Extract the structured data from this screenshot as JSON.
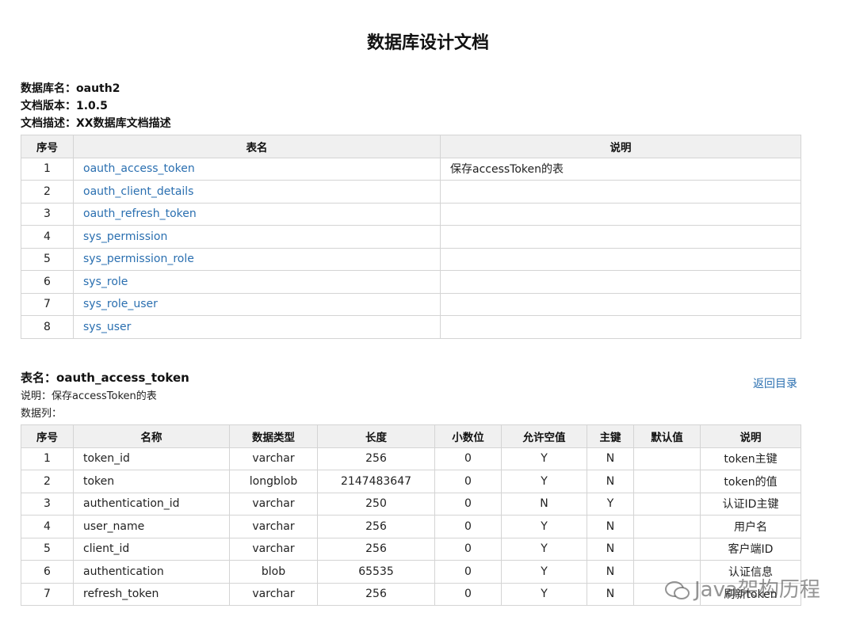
{
  "doc": {
    "title": "数据库设计文档",
    "meta": [
      {
        "label": "数据库名：",
        "value": "oauth2"
      },
      {
        "label": "文档版本：",
        "value": "1.0.5"
      },
      {
        "label": "文档描述：",
        "value": "XX数据库文档描述"
      }
    ]
  },
  "index_table": {
    "headers": [
      "序号",
      "表名",
      "说明"
    ],
    "rows": [
      {
        "no": "1",
        "name": "oauth_access_token",
        "desc": "保存accessToken的表"
      },
      {
        "no": "2",
        "name": "oauth_client_details",
        "desc": ""
      },
      {
        "no": "3",
        "name": "oauth_refresh_token",
        "desc": ""
      },
      {
        "no": "4",
        "name": "sys_permission",
        "desc": ""
      },
      {
        "no": "5",
        "name": "sys_permission_role",
        "desc": ""
      },
      {
        "no": "6",
        "name": "sys_role",
        "desc": ""
      },
      {
        "no": "7",
        "name": "sys_role_user",
        "desc": ""
      },
      {
        "no": "8",
        "name": "sys_user",
        "desc": ""
      }
    ]
  },
  "section": {
    "table_label": "表名：",
    "table_name": "oauth_access_token",
    "desc_line": "说明：保存accessToken的表",
    "columns_label": "数据列：",
    "back_link": "返回目录"
  },
  "columns_table": {
    "headers": [
      "序号",
      "名称",
      "数据类型",
      "长度",
      "小数位",
      "允许空值",
      "主键",
      "默认值",
      "说明"
    ],
    "rows": [
      [
        "1",
        "token_id",
        "varchar",
        "256",
        "0",
        "Y",
        "N",
        "",
        "token主键"
      ],
      [
        "2",
        "token",
        "longblob",
        "2147483647",
        "0",
        "Y",
        "N",
        "",
        "token的值"
      ],
      [
        "3",
        "authentication_id",
        "varchar",
        "250",
        "0",
        "N",
        "Y",
        "",
        "认证ID主键"
      ],
      [
        "4",
        "user_name",
        "varchar",
        "256",
        "0",
        "Y",
        "N",
        "",
        "用户名"
      ],
      [
        "5",
        "client_id",
        "varchar",
        "256",
        "0",
        "Y",
        "N",
        "",
        "客户端ID"
      ],
      [
        "6",
        "authentication",
        "blob",
        "65535",
        "0",
        "Y",
        "N",
        "",
        "认证信息"
      ],
      [
        "7",
        "refresh_token",
        "varchar",
        "256",
        "0",
        "Y",
        "N",
        "",
        "刷新token"
      ]
    ]
  },
  "watermark": {
    "text": "Java架构历程",
    "icon": "wechat-icon"
  }
}
